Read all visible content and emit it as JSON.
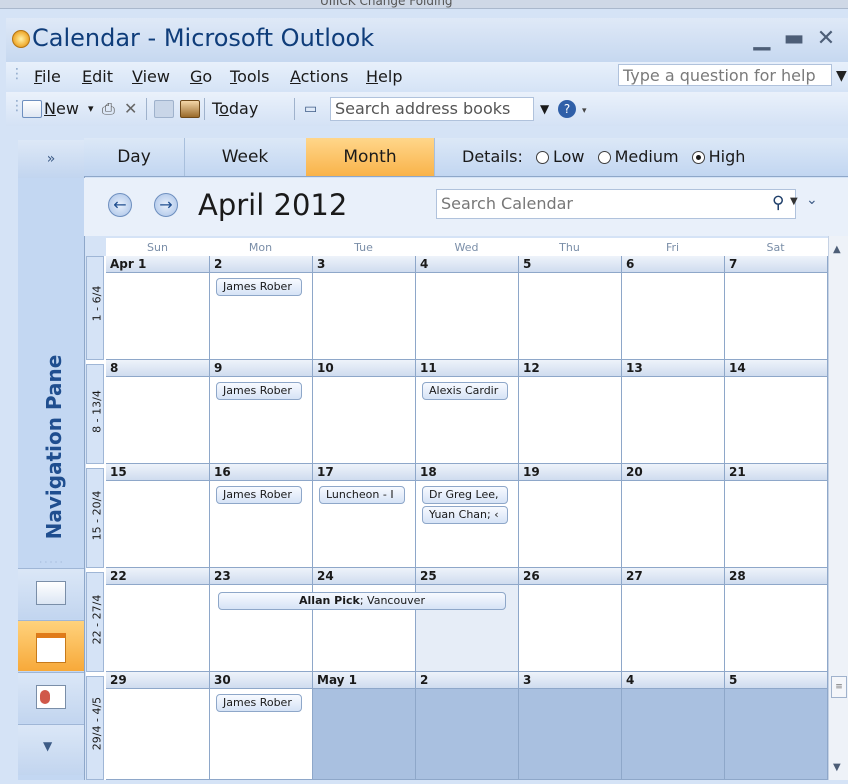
{
  "window": {
    "title": "Calendar - Microsoft Outlook",
    "behind_text": "UIIICK  Change  Folding"
  },
  "menu": [
    {
      "key": "F",
      "rest": "ile"
    },
    {
      "key": "E",
      "rest": "dit"
    },
    {
      "key": "V",
      "rest": "iew"
    },
    {
      "key": "G",
      "rest": "o"
    },
    {
      "key": "T",
      "rest": "ools"
    },
    {
      "key": "A",
      "rest": "ctions"
    },
    {
      "key": "H",
      "rest": "elp"
    }
  ],
  "help_placeholder": "Type a question for help",
  "toolbar": {
    "new_key": "N",
    "new_rest": "ew",
    "today_key": "o",
    "today_label_pre": "T",
    "today_label_post": "day",
    "search_address": "Search address books"
  },
  "view_tabs": [
    "Day",
    "Week",
    "Month"
  ],
  "active_tab": "Month",
  "details": {
    "label": "Details:",
    "options": [
      "Low",
      "Medium",
      "High"
    ],
    "selected": "High"
  },
  "nav_pane": {
    "title": "Navigation Pane",
    "collapse": "»"
  },
  "calendar": {
    "title": "April 2012",
    "search_placeholder": "Search Calendar",
    "day_names": [
      "Sun",
      "Mon",
      "Tue",
      "Wed",
      "Thu",
      "Fri",
      "Sat"
    ],
    "weeks": [
      {
        "label": "1 - 6/4",
        "days": [
          "Apr 1",
          "2",
          "3",
          "4",
          "5",
          "6",
          "7"
        ]
      },
      {
        "label": "8 - 13/4",
        "days": [
          "8",
          "9",
          "10",
          "11",
          "12",
          "13",
          "14"
        ]
      },
      {
        "label": "15 - 20/4",
        "days": [
          "15",
          "16",
          "17",
          "18",
          "19",
          "20",
          "21"
        ]
      },
      {
        "label": "22 - 27/4",
        "days": [
          "22",
          "23",
          "24",
          "25",
          "26",
          "27",
          "28"
        ]
      },
      {
        "label": "29/4 - 4/5",
        "days": [
          "29",
          "30",
          "May 1",
          "2",
          "3",
          "4",
          "5"
        ]
      }
    ],
    "events": {
      "w0_mon": "James Rober",
      "w1_mon": "James Rober",
      "w1_wed": "Alexis Cardir",
      "w2_mon": "James Rober",
      "w2_tue": "Luncheon - I",
      "w2_wed_1": "Dr Greg Lee,",
      "w2_wed_2": "Yuan Chan; ‹",
      "w3_span_bold": "Allan Pick",
      "w3_span_rest": "; Vancouver",
      "w4_mon": "James Rober"
    }
  }
}
